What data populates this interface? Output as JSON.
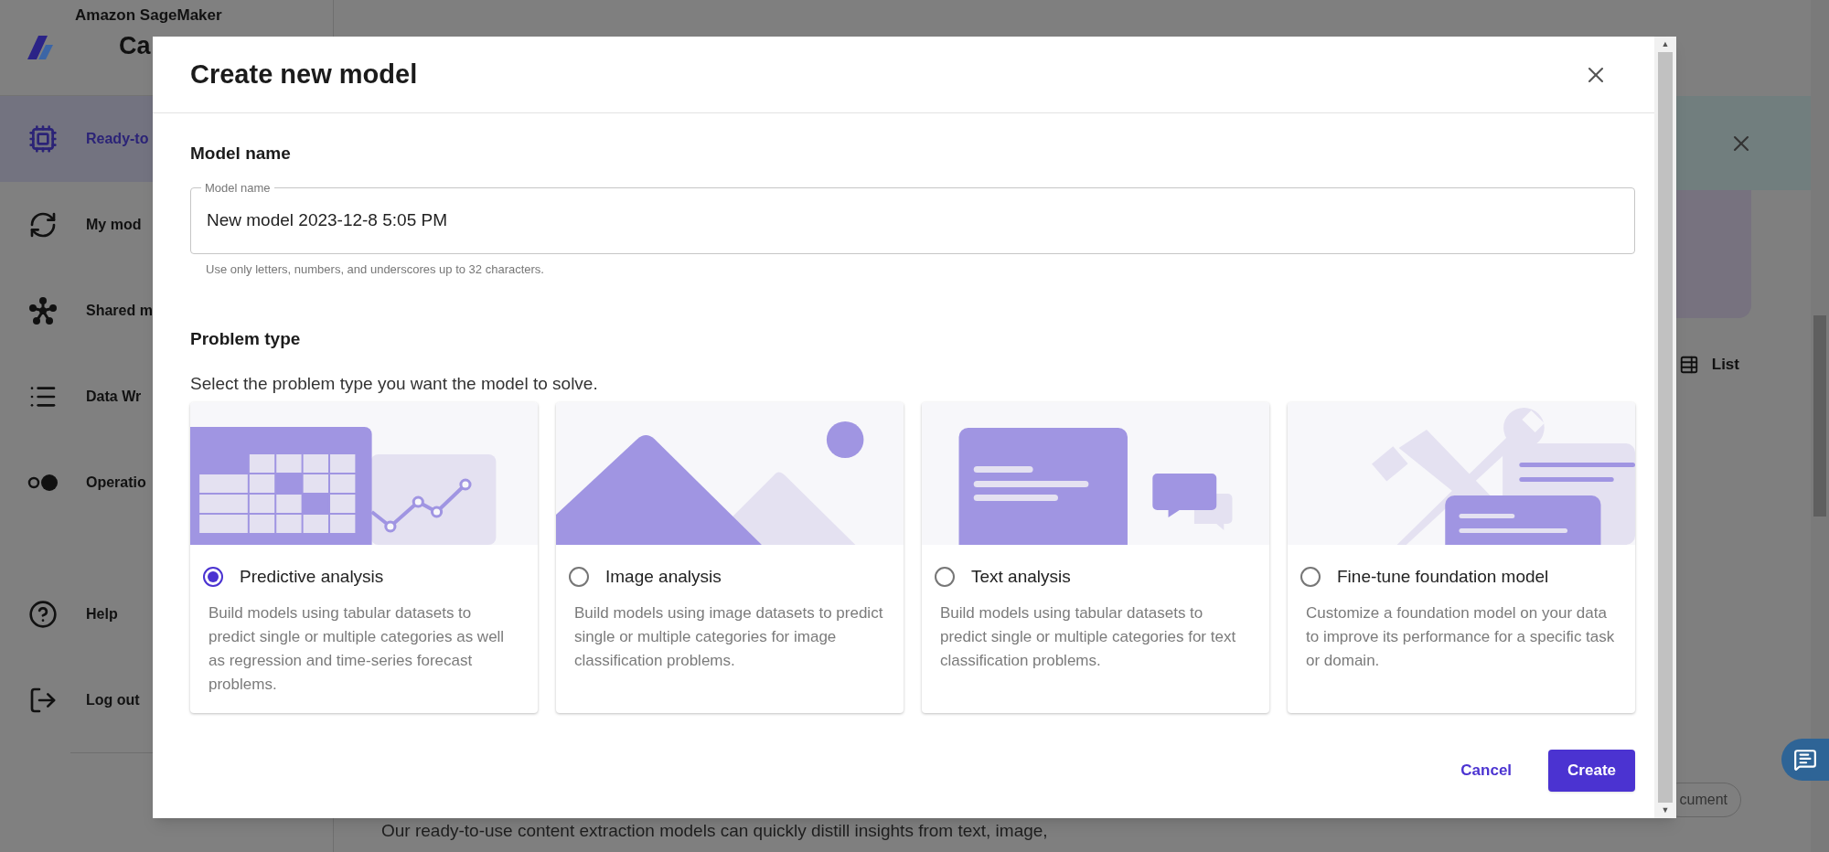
{
  "sidebar": {
    "brand": "Amazon SageMaker",
    "app_name": "Ca",
    "items": [
      {
        "label": "Ready-to",
        "kind": "chip",
        "selected": true
      },
      {
        "label": "My mod",
        "kind": "refresh",
        "selected": false
      },
      {
        "label": "Shared m",
        "kind": "nodes",
        "selected": false
      },
      {
        "label": "Data Wr",
        "kind": "list",
        "selected": false
      },
      {
        "label": "Operatio",
        "kind": "dots",
        "selected": false
      }
    ],
    "footer_items": [
      {
        "label": "Help",
        "kind": "help"
      },
      {
        "label": "Log out",
        "kind": "logout"
      }
    ]
  },
  "main": {
    "view_toggle": "List",
    "filter_chip": "cument",
    "description": "Our ready-to-use content extraction models can quickly distill insights from text, image,"
  },
  "dialog": {
    "title": "Create new model",
    "model_name": {
      "heading": "Model name",
      "label": "Model name",
      "value": "New model 2023-12-8 5:05 PM",
      "hint": "Use only letters, numbers, and underscores up to 32 characters."
    },
    "problem_type": {
      "heading": "Problem type",
      "instruction": "Select the problem type you want the model to solve.",
      "options": [
        {
          "kind": "predictive",
          "title": "Predictive analysis",
          "description": "Build models using tabular datasets to predict single or multiple categories as well as regression and time-series forecast problems.",
          "selected": true
        },
        {
          "kind": "image",
          "title": "Image analysis",
          "description": "Build models using image datasets to predict single or multiple categories for image classification problems.",
          "selected": false
        },
        {
          "kind": "text",
          "title": "Text analysis",
          "description": "Build models using tabular datasets to predict single or multiple categories for text classification problems.",
          "selected": false
        },
        {
          "kind": "finetune",
          "title": "Fine-tune foundation model",
          "description": "Customize a foundation model on your data to improve its performance for a specific task or domain.",
          "selected": false
        }
      ]
    },
    "buttons": {
      "cancel": "Cancel",
      "create": "Create"
    },
    "scrollbar": {
      "up": "▲",
      "down": "▼"
    }
  }
}
